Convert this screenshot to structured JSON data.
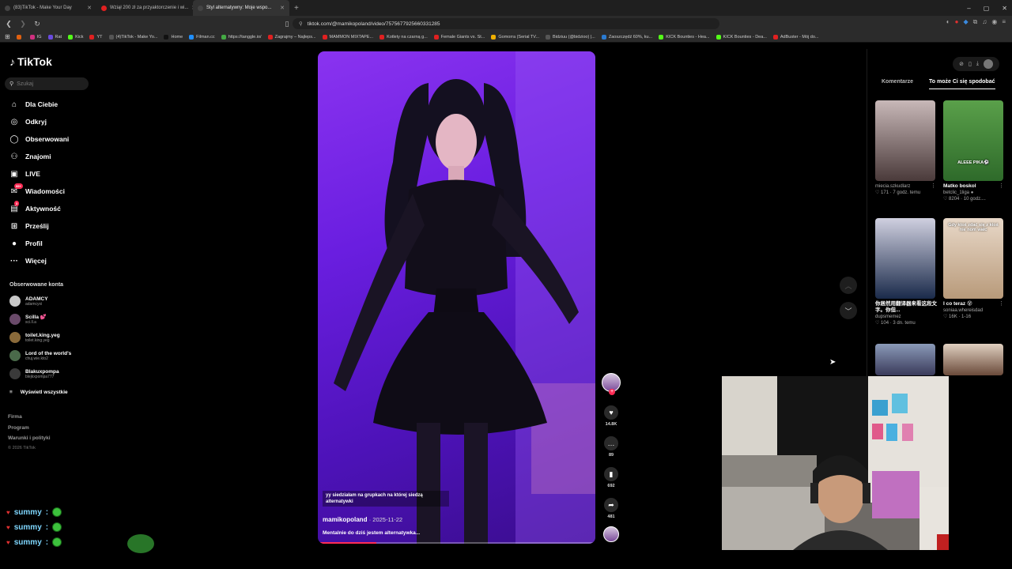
{
  "browser": {
    "tabs": [
      {
        "title": "(83)TikTok - Make Your Day",
        "color": "#000000",
        "active": false
      },
      {
        "title": "Wziął 200 zł za przyaktorczenie i wi...",
        "color": "#e02020",
        "active": false
      },
      {
        "title": "Styl alternatywny: Moje wspo...",
        "color": "#000000",
        "active": true
      }
    ],
    "new_tab": "+",
    "url": "tiktok.com/@mamikopoland/video/7575677925660331285",
    "window_controls": [
      "–",
      "▢",
      "✕"
    ],
    "bookmarks": [
      {
        "label": "",
        "color": "#e06010"
      },
      {
        "label": "IG",
        "color": "#d03080"
      },
      {
        "label": "Rat",
        "color": "#6a4adf"
      },
      {
        "label": "Kick",
        "color": "#53fc18"
      },
      {
        "label": "YT",
        "color": "#e02020"
      },
      {
        "label": "(4)TikTok - Make Yo...",
        "color": "#000000"
      },
      {
        "label": "Home",
        "color": "#111111"
      },
      {
        "label": "Filman.cc",
        "color": "#1f8fff"
      },
      {
        "label": "https://tanggle.io/",
        "color": "#44aa44"
      },
      {
        "label": "Zagrajmy – Najleps...",
        "color": "#e02020"
      },
      {
        "label": "MAMMON MIXTAPE...",
        "color": "#e02020"
      },
      {
        "label": "Kotlety na czarną g...",
        "color": "#e02020"
      },
      {
        "label": "Female Giants vs. St...",
        "color": "#e02020"
      },
      {
        "label": "Gomorra (Serial TV...",
        "color": "#f0b000"
      },
      {
        "label": "Bidziuu (@bidzioo) |...",
        "color": "#000000"
      },
      {
        "label": "Zaoszczędź 60%, ku...",
        "color": "#2a7ad0"
      },
      {
        "label": "KICK Bounties - Hea...",
        "color": "#53fc18"
      },
      {
        "label": "KICK Bounties - Dea...",
        "color": "#53fc18"
      },
      {
        "label": "AdBuster - Mój do...",
        "color": "#e02020"
      }
    ]
  },
  "tiktok": {
    "logo": "TikTok",
    "search_placeholder": "Szukaj",
    "nav": [
      {
        "label": "Dla Ciebie",
        "icon": "home-icon",
        "glyph": "⌂"
      },
      {
        "label": "Odkryj",
        "icon": "compass-icon",
        "glyph": "◎"
      },
      {
        "label": "Obserwowani",
        "icon": "following-icon",
        "glyph": "◯"
      },
      {
        "label": "Znajomi",
        "icon": "friends-icon",
        "glyph": "⚇"
      },
      {
        "label": "LIVE",
        "icon": "live-icon",
        "glyph": "▣"
      },
      {
        "label": "Wiadomości",
        "icon": "messages-icon",
        "glyph": "✉",
        "badge": "99+"
      },
      {
        "label": "Aktywność",
        "icon": "activity-icon",
        "glyph": "▤",
        "badge": "3"
      },
      {
        "label": "Prześlij",
        "icon": "upload-icon",
        "glyph": "⊞"
      },
      {
        "label": "Profil",
        "icon": "profile-icon",
        "glyph": "●"
      },
      {
        "label": "Więcej",
        "icon": "more-icon",
        "glyph": "···"
      }
    ],
    "followed_title": "Obserwowane konta",
    "followed_accounts": [
      {
        "name": "ADAMCY",
        "handle": "adamcyxi",
        "color": "#c8c8c8"
      },
      {
        "name": "Scilla 💕",
        "handle": "sci.ll.a",
        "color": "#6a4a6a"
      },
      {
        "name": "toilet.king.yeg",
        "handle": "toilet.king.yeg",
        "color": "#8a6a3a"
      },
      {
        "name": "Lord of the world's",
        "handle": "chuj.wie.kto2",
        "color": "#4a6a4a"
      },
      {
        "name": "Blakuxpompa",
        "handle": "blejkxpompa777",
        "color": "#3a3a3a"
      }
    ],
    "show_all": "Wyświetl wszystkie",
    "footer_links": [
      "Firma",
      "Program",
      "Warunki i polityki"
    ],
    "copyright": "© 2026 TikTok"
  },
  "video": {
    "caption": "yy siedziałam na grupkach na której siedzą alternatywki",
    "author": "mamikopoland",
    "date": "2025-11-22",
    "description": "Mentalnie do dziś jestem alternatywka...",
    "progress": 0.21
  },
  "actions": {
    "likes": "14.8K",
    "comments": "89",
    "saves": "692",
    "shares": "481"
  },
  "right_panel": {
    "tabs": [
      "Komentarze",
      "To może Ci się spodobać"
    ],
    "active_tab": 1,
    "thumbnails": [
      {
        "title": "",
        "user": "miecia.szkudlarz",
        "stats": "♡ 171 · 7 godz. temu",
        "overlay": "",
        "colors": [
          "#c8b8b8",
          "#4a3a3a"
        ]
      },
      {
        "title": "Matko boskol",
        "user": "betclic_1liga ●",
        "stats": "♡ 8204 · 10 godz....",
        "overlay": "ALEEE PIKA⚽",
        "colors": [
          "#5aa04a",
          "#2e6a2a"
        ]
      },
      {
        "title": "你居然用翻译器来看这段文字。你但...",
        "user": "dupsmemez",
        "stats": "♡ 104 · 3 dn. temu",
        "overlay": "",
        "colors": [
          "#d0d0e0",
          "#1a2a4a"
        ]
      },
      {
        "title": "I co teraz 😵",
        "user": "soniaa.whereisdad",
        "stats": "♡ 16K · 1-16",
        "overlay": "Gdy ktoś zdać się z ktoś nie nom wałc",
        "colors": [
          "#e8d8c8",
          "#b89a7a"
        ]
      },
      {
        "title": "",
        "user": "",
        "stats": "",
        "overlay": "",
        "colors": [
          "#8a9ab8",
          "#3a3a5a"
        ]
      },
      {
        "title": "",
        "user": "",
        "stats": "",
        "overlay": "",
        "colors": [
          "#e0d0c0",
          "#6a4a3a"
        ]
      }
    ]
  },
  "chat": [
    {
      "user": "summy",
      "sep": ":"
    },
    {
      "user": "summy",
      "sep": ":"
    },
    {
      "user": "summy",
      "sep": ":"
    }
  ]
}
